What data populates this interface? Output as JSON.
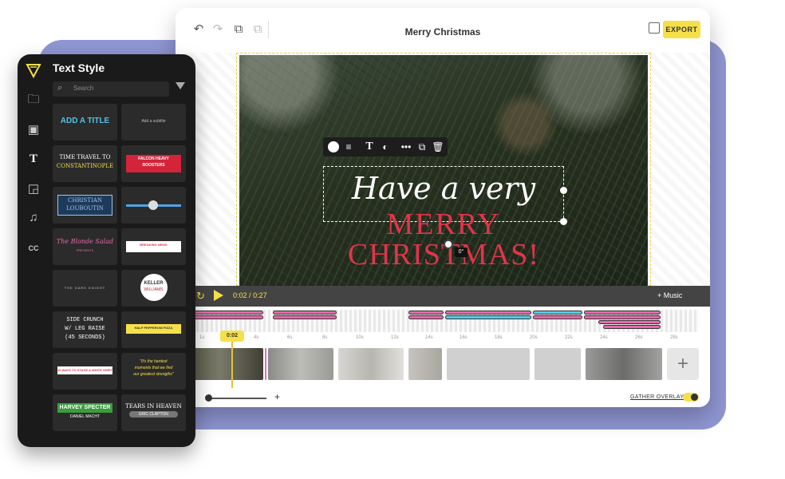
{
  "editor": {
    "title": "Merry Christmas",
    "export_label": "EXPORT"
  },
  "canvas": {
    "script_text": "Have a very",
    "line1": "MERRY",
    "line2": "CHRISTMAS!",
    "rotation": "0°"
  },
  "player": {
    "current_time": "0:02",
    "total_time": "0:27",
    "time_sep": "/",
    "music_label": "+ Music",
    "playhead_label": "0:02"
  },
  "timeline": {
    "ruler_labels": [
      "1s",
      "4s",
      "6s",
      "8s",
      "10s",
      "12s",
      "14s",
      "16s",
      "18s",
      "20s",
      "22s",
      "24s",
      "26s",
      "28s"
    ],
    "gather_overlays_label": "GATHER OVERLAYS",
    "add_clip_label": "+",
    "zoom_plus": "+"
  },
  "panel": {
    "title": "Text Style",
    "search_placeholder": "Search",
    "tiles": [
      {
        "lines": [
          "ADD A TITLE"
        ],
        "color": "#4fc3e8"
      },
      {
        "lines": [
          "Add a subtitle"
        ],
        "color": "#bbbbbb"
      },
      {
        "lines": [
          "TIME TRAVEL TO",
          "CONSTANTINOPLE"
        ],
        "color": "#f6e04a"
      },
      {
        "lines": [
          "FALCON HEAVY",
          "BOOSTERS"
        ],
        "color": "#ffffff"
      },
      {
        "lines": [
          "CHRISTIAN",
          "LOUBOUTIN"
        ],
        "color": "#9ec6e8"
      },
      {
        "lines": [],
        "color": "#cccccc"
      },
      {
        "lines": [
          "The Blonde Salad",
          "PRESENTS"
        ],
        "color": "#e56aaa"
      },
      {
        "lines": [
          "BREAKING NEWS"
        ],
        "color": "#e0354a"
      },
      {
        "lines": [
          "THE DARK KNIGHT"
        ],
        "color": "#cccccc"
      },
      {
        "lines": [
          "KELLER",
          "WILLIAMS"
        ],
        "color": "#b3223a"
      },
      {
        "lines": [
          "SIDE CRUNCH",
          "W/ LEG RAISE",
          "(45 SECONDS)"
        ],
        "color": "#ffffff"
      },
      {
        "lines": [
          "HALF PEPPERONI PIZZA"
        ],
        "color": "#f6e04a"
      },
      {
        "lines": [
          "10 WAYS TO STAGE A WHITE SHIRT"
        ],
        "color": "#e0354a"
      },
      {
        "lines": [
          "\"It's the hardest",
          "moments that we find",
          "our greatest strengths\""
        ],
        "color": "#f6e04a"
      },
      {
        "lines": [
          "HARVEY SPECTER",
          "DANIEL MACHT"
        ],
        "color": "#ffffff"
      },
      {
        "lines": [
          "TEARS IN HEAVEN",
          "ERIC CLAPTON"
        ],
        "color": "#ffffff"
      }
    ]
  },
  "colors": {
    "accent": "#f6e04a",
    "overlay_pink": "#e56aaa",
    "overlay_blue": "#5ac8e8",
    "title_red": "#e0354a",
    "backdrop": "#8f96d2"
  }
}
